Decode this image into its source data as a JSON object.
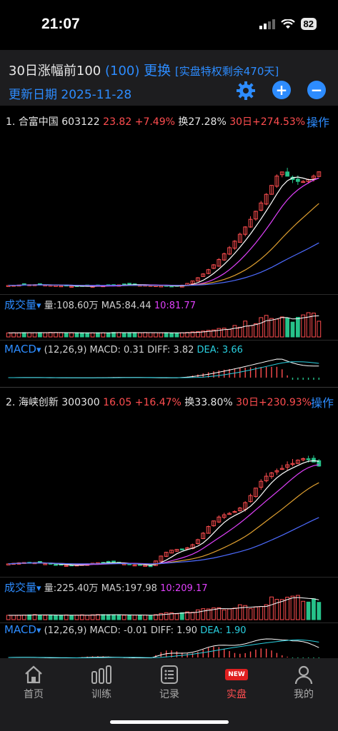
{
  "status_bar": {
    "time": "21:07",
    "battery": "82"
  },
  "header": {
    "title": "30日涨幅前100",
    "count": "(100)",
    "change_label": "更换",
    "privilege": "[实盘特权剩余470天]",
    "update_date": "更新日期 2025-11-28"
  },
  "stocks": [
    {
      "index": "1.",
      "name": "合富中国",
      "code": "603122",
      "price": "23.82",
      "change": "+7.49%",
      "turnover": "换27.28%",
      "gain30": "30日+274.53%",
      "action": "操作",
      "volume": {
        "label": "成交量",
        "amount": "量:108.60万",
        "ma5": "MA5:84.44",
        "ma10": "10:81.77"
      },
      "macd": {
        "label": "MACD",
        "params": "(12,26,9)",
        "macd": "MACD: 0.31",
        "diff": "DIFF: 3.82",
        "dea": "DEA: 3.66"
      }
    },
    {
      "index": "2.",
      "name": "海峡创新",
      "code": "300300",
      "price": "16.05",
      "change": "+16.47%",
      "turnover": "换33.80%",
      "gain30": "30日+230.93%",
      "action": "操作",
      "volume": {
        "label": "成交量",
        "amount": "量:225.40万",
        "ma5": "MA5:197.98",
        "ma10": "10:209.17"
      },
      "macd": {
        "label": "MACD",
        "params": "(12,26,9)",
        "macd": "MACD: -0.01",
        "diff": "DIFF: 1.90",
        "dea": "DEA: 1.90"
      }
    }
  ],
  "tabs": [
    {
      "label": "首页",
      "icon": "home-icon"
    },
    {
      "label": "训练",
      "icon": "bar-chart-icon"
    },
    {
      "label": "记录",
      "icon": "list-icon"
    },
    {
      "label": "实盘",
      "icon": "new-badge-icon",
      "badge": "NEW"
    },
    {
      "label": "我的",
      "icon": "user-icon"
    }
  ],
  "colors": {
    "up": "#ff4d4f",
    "down": "#26c28a",
    "accent": "#2d8cff",
    "ma5": "#ffffff",
    "ma10": "#e040fb",
    "ma20": "#e0a030",
    "ma60": "#4d6bff"
  }
}
